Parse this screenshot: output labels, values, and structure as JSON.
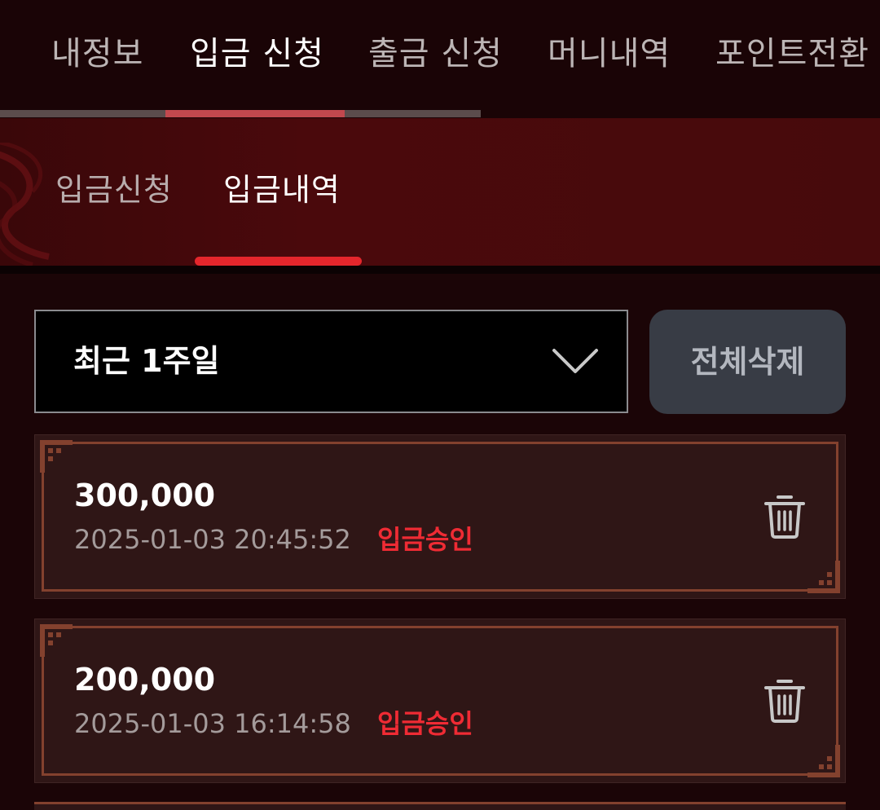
{
  "top_nav": {
    "tabs": [
      {
        "label": "내정보",
        "active": false
      },
      {
        "label": "입금 신청",
        "active": true
      },
      {
        "label": "출금 신청",
        "active": false
      },
      {
        "label": "머니내역",
        "active": false
      },
      {
        "label": "포인트전환",
        "active": false
      }
    ]
  },
  "sub_nav": {
    "tabs": [
      {
        "label": "입금신청",
        "active": false
      },
      {
        "label": "입금내역",
        "active": true
      }
    ]
  },
  "filter": {
    "period_selected": "최근 1주일",
    "dropdown_icon": "chevron-down-icon",
    "delete_all_label": "전체삭제"
  },
  "deposits": [
    {
      "amount": "300,000",
      "datetime": "2025-01-03 20:45:52",
      "status": "입금승인",
      "action_icon": "trash-icon"
    },
    {
      "amount": "200,000",
      "datetime": "2025-01-03 16:14:58",
      "status": "입금승인",
      "action_icon": "trash-icon"
    }
  ],
  "colors": {
    "background": "#1b0507",
    "header_red": "#470a0c",
    "accent_red": "#e4262c",
    "status_red": "#ef2b34",
    "card_bg": "#2f1616",
    "card_border": "#83412e",
    "button_bg": "#383c45"
  }
}
